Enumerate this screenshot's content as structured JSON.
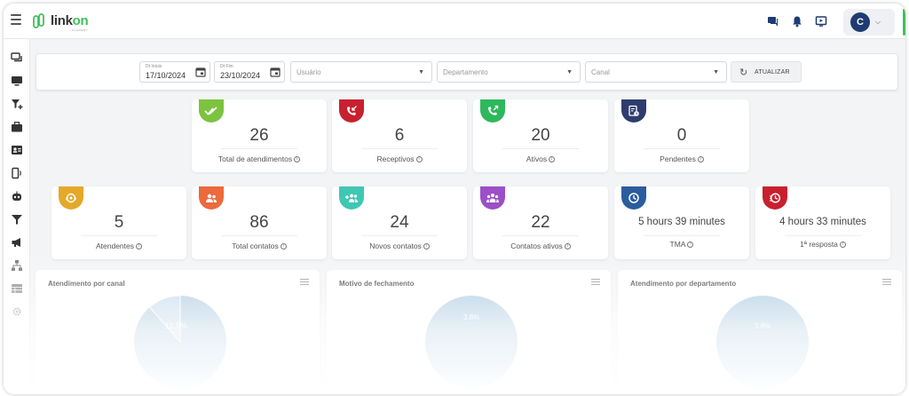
{
  "app": {
    "logo_main": "link",
    "logo_accent": "on",
    "logo_sub": "ACADEMY",
    "user_initial": "C",
    "accent_color": "#3ec15a"
  },
  "filters": {
    "date_start_label": "Dt Início",
    "date_start_value": "17/10/2024",
    "date_end_label": "Dt Fim",
    "date_end_value": "23/10/2024",
    "user_placeholder": "Usuário",
    "department_placeholder": "Departamento",
    "channel_placeholder": "Canal",
    "refresh_label": "ATUALIZAR"
  },
  "stats_row1": [
    {
      "value": "26",
      "label": "Total de atendimentos",
      "icon": "double-check-icon",
      "color": "#7cc33f"
    },
    {
      "value": "6",
      "label": "Receptivos",
      "icon": "incoming-call-icon",
      "color": "#c8202f"
    },
    {
      "value": "20",
      "label": "Ativos",
      "icon": "outgoing-call-icon",
      "color": "#2eb85c"
    },
    {
      "value": "0",
      "label": "Pendentes",
      "icon": "pending-document-icon",
      "color": "#2f3d6e"
    }
  ],
  "stats_row2": [
    {
      "value": "5",
      "label": "Atendentes",
      "icon": "agent-headset-icon",
      "color": "#e4a92a"
    },
    {
      "value": "86",
      "label": "Total contatos",
      "icon": "contacts-icon",
      "color": "#ec6a3c"
    },
    {
      "value": "24",
      "label": "Novos contatos",
      "icon": "new-contacts-icon",
      "color": "#3fc7b4"
    },
    {
      "value": "22",
      "label": "Contatos ativos",
      "icon": "active-contacts-icon",
      "color": "#9b4fc8"
    },
    {
      "value": "5 hours 39 minutes",
      "label": "TMA",
      "icon": "clock-icon",
      "color": "#2b5d9e"
    },
    {
      "value": "4 hours 33 minutes",
      "label": "1ª resposta",
      "icon": "response-clock-icon",
      "color": "#c8202f"
    }
  ],
  "panels": [
    {
      "title": "Atendimento por canal",
      "slice_label": "11.5%",
      "slice_fraction": 0.115
    },
    {
      "title": "Motivo de fechamento",
      "slice_label": "3.8%",
      "slice_fraction": 0.0
    },
    {
      "title": "Atendimento por departamento",
      "slice_label": "3.8%",
      "slice_fraction": 0.0
    }
  ]
}
